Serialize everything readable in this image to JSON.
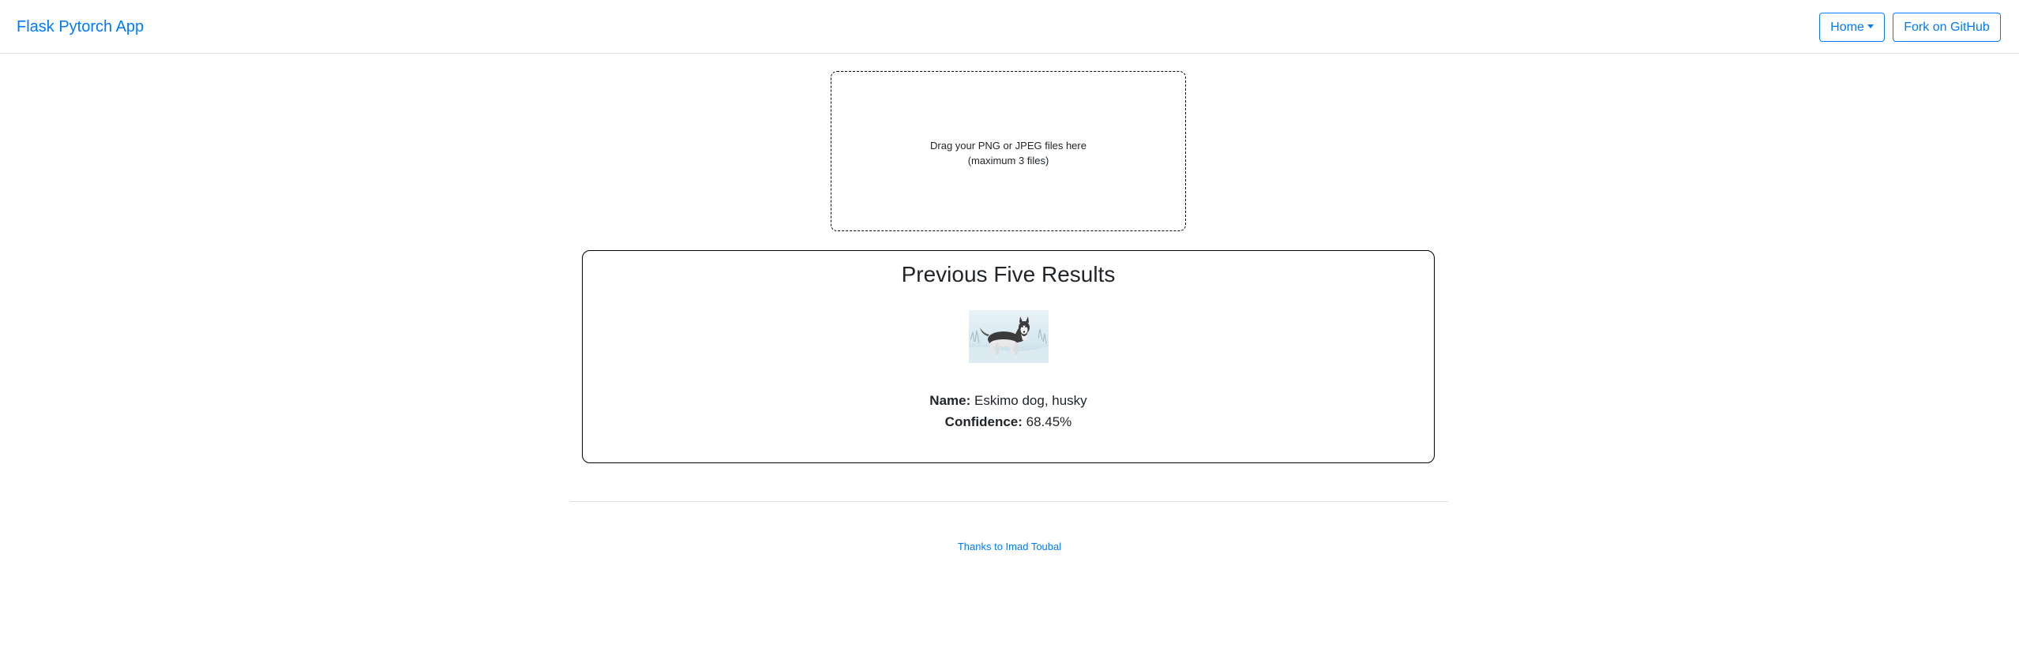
{
  "navbar": {
    "brand": "Flask Pytorch App",
    "home_label": "Home",
    "fork_label": "Fork on GitHub"
  },
  "dropzone": {
    "line1": "Drag your PNG or JPEG files here",
    "line2": "(maximum 3 files)"
  },
  "results": {
    "title": "Previous Five Results",
    "items": [
      {
        "image": "husky-photo",
        "name_label": "Name:",
        "name_value": "Eskimo dog, husky",
        "confidence_label": "Confidence:",
        "confidence_value": "68.45%"
      }
    ]
  },
  "footer": {
    "link_text": "Thanks to Imad Toubal"
  },
  "colors": {
    "accent": "#007bff",
    "text": "#212529",
    "divider": "#dee2e6"
  }
}
